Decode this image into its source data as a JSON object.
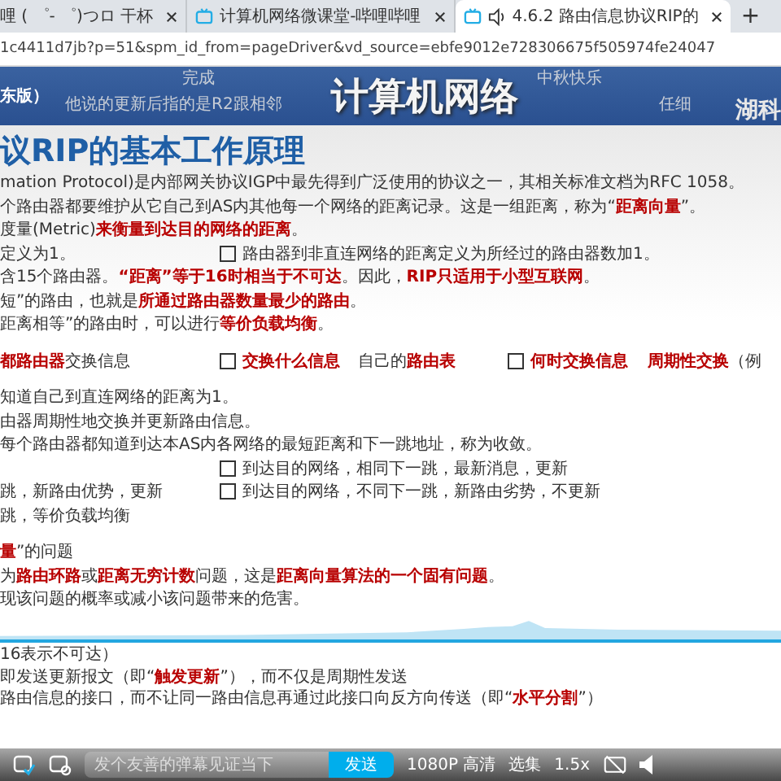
{
  "browser": {
    "tabs": [
      {
        "title": "哩 ( ゜- ゜)つロ 干杯",
        "selected": false,
        "kind": "plain"
      },
      {
        "title": "计算机网络微课堂-哔哩哔哩",
        "selected": false,
        "kind": "video"
      },
      {
        "title": "4.6.2 路由信息协议RIP的",
        "selected": true,
        "kind": "playing"
      }
    ],
    "new_tab": "+",
    "url": "1c4411d7jb?p=51&spm_id_from=pageDriver&vd_source=ebfe9012e728306675f505974fe24047"
  },
  "banner": {
    "left": "东版）",
    "title": "计算机网络",
    "right": "湖科"
  },
  "danmaku": [
    {
      "text": "完成"
    },
    {
      "text": "中秋快乐"
    },
    {
      "text": "他说的更新后指的是R2跟相邻"
    },
    {
      "text": "任细"
    }
  ],
  "slide": {
    "title": "议RIP的基本工作原理",
    "sections": [
      [
        {
          "kind": "wide",
          "cells": [
            {
              "kind": "plain",
              "text": "mation Protocol)是内部网关协议IGP中最先得到广泛使用的协议之一，其相关标准文档为RFC 1058。"
            }
          ]
        },
        {
          "kind": "wide",
          "cells": [
            {
              "kind": "plain",
              "text": "个路由器都要维护从它自己到AS内其他每一个网络的距离记录。这是一组距离，称为“**距离向量**”。"
            }
          ]
        },
        {
          "kind": "wide",
          "cells": [
            {
              "kind": "plain",
              "text": "度量(Metric)**来衡量到达目的网络的距离**。"
            }
          ]
        },
        {
          "kind": "columns",
          "cells": [
            {
              "kind": "plain",
              "text": "定义为1。"
            },
            {
              "kind": "bullet",
              "text": "路由器到非直连网络的距离定义为所经过的路由器数加1。"
            }
          ]
        },
        {
          "kind": "wide",
          "cells": [
            {
              "kind": "plain",
              "text": "含15个路由器。**“距离”等于16时相当于不可达**。因此，**RIP只适用于小型互联网**。"
            }
          ]
        },
        {
          "kind": "wide",
          "cells": [
            {
              "kind": "plain",
              "text": "短”的路由，也就是**所通过路由器数量最少的路由**。"
            }
          ]
        },
        {
          "kind": "wide",
          "cells": [
            {
              "kind": "plain",
              "text": "距离相等”的路由时，可以进行**等价负载均衡**。"
            }
          ]
        }
      ],
      [
        {
          "kind": "columns",
          "cells": [
            {
              "kind": "plain",
              "text": "**都路由器**交换信息"
            },
            {
              "kind": "bullet",
              "text": "**交换什么信息**"
            },
            {
              "kind": "plain",
              "text": "自己的**路由表**"
            },
            {
              "kind": "bullet",
              "text": "**何时交换信息**"
            },
            {
              "kind": "plain",
              "text": "**周期性交换**（例"
            }
          ]
        }
      ],
      [
        {
          "kind": "wide",
          "cells": [
            {
              "kind": "plain",
              "text": "知道自己到直连网络的距离为1。"
            }
          ]
        },
        {
          "kind": "wide",
          "cells": [
            {
              "kind": "plain",
              "text": "由器周期性地交换并更新路由信息。"
            }
          ]
        },
        {
          "kind": "wide",
          "cells": [
            {
              "kind": "plain",
              "text": "每个路由器都知道到达本AS内各网络的最短距离和下一跳地址，称为收敛。"
            }
          ]
        },
        {
          "kind": "indented",
          "cells": [
            {
              "kind": "bullet",
              "text": "到达目的网络，相同下一跳，最新消息，更新"
            }
          ]
        },
        {
          "kind": "columns",
          "cells": [
            {
              "kind": "plain",
              "text": "跳，新路由优势，更新"
            },
            {
              "kind": "bullet",
              "text": "到达目的网络，不同下一跳，新路由劣势，不更新"
            }
          ]
        },
        {
          "kind": "wide",
          "cells": [
            {
              "kind": "plain",
              "text": "跳，等价负载均衡"
            }
          ]
        }
      ],
      [
        {
          "kind": "wide",
          "cells": [
            {
              "kind": "plain",
              "text": "**量**”的问题"
            }
          ]
        },
        {
          "kind": "wide",
          "cells": [
            {
              "kind": "plain",
              "text": "为**路由环路**或**距离无穷计数**问题，这是**距离向量算法的一个固有问题**。"
            }
          ]
        },
        {
          "kind": "wide",
          "cells": [
            {
              "kind": "plain",
              "text": "现该问题的概率或减小该问题带来的危害。"
            }
          ]
        }
      ]
    ],
    "bottom_lines": [
      "16表示不可达）",
      "即发送更新报文（即“**触发更新**”），而不仅是周期性发送",
      "路由信息的接口，而不让同一路由信息再通过此接口向反方向传送（即“**水平分割**”）"
    ]
  },
  "player": {
    "progress": {
      "level": 1
    },
    "placeholder": "发个友善的弹幕见证当下",
    "send": "发送",
    "quality": "1080P 高清",
    "episodes": "选集",
    "speed": "1.5x"
  }
}
